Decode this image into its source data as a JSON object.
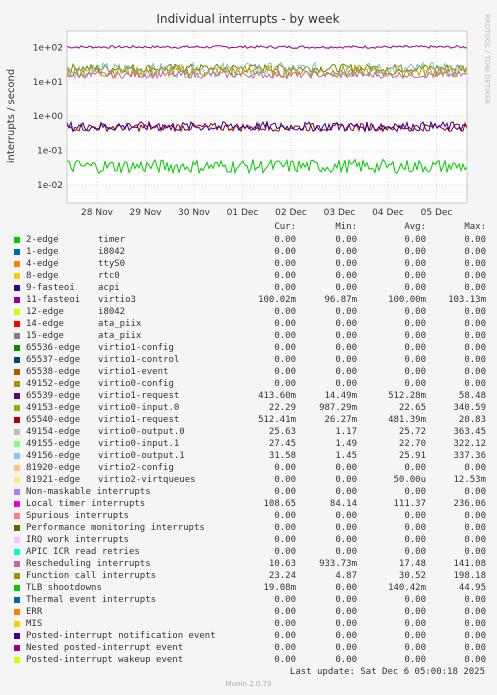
{
  "chart_data": {
    "type": "line",
    "title": "Individual interrupts - by week",
    "ylabel": "interrupts / second",
    "yscale": "log",
    "ylim": [
      0.003,
      300
    ],
    "y_ticks": [
      "1e+02",
      "1e+01",
      "1e+00",
      "1e-01",
      "1e-02"
    ],
    "x_ticks": [
      "28 Nov",
      "29 Nov",
      "30 Nov",
      "01 Dec",
      "02 Dec",
      "03 Dec",
      "04 Dec",
      "05 Dec"
    ],
    "side_label": "RRDTOOL / TOBI OETIKER",
    "series_bands": [
      {
        "name": "11-fasteoi virtio3",
        "color": "#990099",
        "level": 103,
        "noise": 0.04
      },
      {
        "name": "49153-edge virtio0-input.0",
        "color": "#7a7a00",
        "level": 25,
        "noise": 0.12
      },
      {
        "name": "49154-edge virtio0-output.0",
        "color": "#80c0c0",
        "level": 22,
        "noise": 0.22
      },
      {
        "name": "Local timer interrupts",
        "color": "#b0a000",
        "level": 20,
        "noise": 0.18
      },
      {
        "name": "Rescheduling interrupts",
        "color": "#cc6699",
        "level": 16,
        "noise": 0.1
      },
      {
        "name": "65540-edge virtio1-request",
        "color": "#990000",
        "level": 0.48,
        "noise": 0.12
      },
      {
        "name": "65539-edge virtio1-request",
        "color": "#330099",
        "level": 0.5,
        "noise": 0.14
      },
      {
        "name": "TLB shootdowns",
        "color": "#00cc00",
        "level": 0.035,
        "noise": 0.2
      }
    ]
  },
  "legend_header": {
    "cur": "Cur:",
    "min": "Min:",
    "avg": "Avg:",
    "max": "Max:"
  },
  "legend": [
    {
      "name": "2-edge",
      "device": "timer",
      "color": "#00cc00",
      "cur": "0.00",
      "min": "0.00",
      "avg": "0.00",
      "max": "0.00"
    },
    {
      "name": "1-edge",
      "device": "i8042",
      "color": "#0066b3",
      "cur": "0.00",
      "min": "0.00",
      "avg": "0.00",
      "max": "0.00"
    },
    {
      "name": "4-edge",
      "device": "ttyS0",
      "color": "#ff8000",
      "cur": "0.00",
      "min": "0.00",
      "avg": "0.00",
      "max": "0.00"
    },
    {
      "name": "8-edge",
      "device": "rtc0",
      "color": "#ffcc00",
      "cur": "0.00",
      "min": "0.00",
      "avg": "0.00",
      "max": "0.00"
    },
    {
      "name": "9-fasteoi",
      "device": "acpi",
      "color": "#330099",
      "cur": "0.00",
      "min": "0.00",
      "avg": "0.00",
      "max": "0.00"
    },
    {
      "name": "11-fasteoi",
      "device": "virtio3",
      "color": "#990099",
      "cur": "100.02m",
      "min": "96.87m",
      "avg": "100.00m",
      "max": "103.13m"
    },
    {
      "name": "12-edge",
      "device": "i8042",
      "color": "#ccff00",
      "cur": "0.00",
      "min": "0.00",
      "avg": "0.00",
      "max": "0.00"
    },
    {
      "name": "14-edge",
      "device": "ata_piix",
      "color": "#ff0000",
      "cur": "0.00",
      "min": "0.00",
      "avg": "0.00",
      "max": "0.00"
    },
    {
      "name": "15-edge",
      "device": "ata_piix",
      "color": "#808080",
      "cur": "0.00",
      "min": "0.00",
      "avg": "0.00",
      "max": "0.00"
    },
    {
      "name": "65536-edge",
      "device": "virtio1-config",
      "color": "#008f00",
      "cur": "0.00",
      "min": "0.00",
      "avg": "0.00",
      "max": "0.00"
    },
    {
      "name": "65537-edge",
      "device": "virtio1-control",
      "color": "#00487d",
      "cur": "0.00",
      "min": "0.00",
      "avg": "0.00",
      "max": "0.00"
    },
    {
      "name": "65538-edge",
      "device": "virtio1-event",
      "color": "#b35a00",
      "cur": "0.00",
      "min": "0.00",
      "avg": "0.00",
      "max": "0.00"
    },
    {
      "name": "49152-edge",
      "device": "virtio0-config",
      "color": "#b38f00",
      "cur": "0.00",
      "min": "0.00",
      "avg": "0.00",
      "max": "0.00"
    },
    {
      "name": "65539-edge",
      "device": "virtio1-request",
      "color": "#6b006b",
      "cur": "413.60m",
      "min": "14.49m",
      "avg": "512.28m",
      "max": "58.48"
    },
    {
      "name": "49153-edge",
      "device": "virtio0-input.0",
      "color": "#8fb300",
      "cur": "22.29",
      "min": "987.29m",
      "avg": "22.65",
      "max": "340.59"
    },
    {
      "name": "65540-edge",
      "device": "virtio1-request",
      "color": "#b30000",
      "cur": "512.41m",
      "min": "26.27m",
      "avg": "481.39m",
      "max": "20.83"
    },
    {
      "name": "49154-edge",
      "device": "virtio0-output.0",
      "color": "#bebebe",
      "cur": "25.63",
      "min": "1.17",
      "avg": "25.72",
      "max": "363.45"
    },
    {
      "name": "49155-edge",
      "device": "virtio0-input.1",
      "color": "#80ff80",
      "cur": "27.45",
      "min": "1.49",
      "avg": "22.70",
      "max": "322.12"
    },
    {
      "name": "49156-edge",
      "device": "virtio0-output.1",
      "color": "#80c9ff",
      "cur": "31.58",
      "min": "1.45",
      "avg": "25.91",
      "max": "337.36"
    },
    {
      "name": "81920-edge",
      "device": "virtio2-config",
      "color": "#ffc080",
      "cur": "0.00",
      "min": "0.00",
      "avg": "0.00",
      "max": "0.00"
    },
    {
      "name": "81921-edge",
      "device": "virtio2-virtqueues",
      "color": "#ffe680",
      "cur": "0.00",
      "min": "0.00",
      "avg": "50.00u",
      "max": "12.53m"
    },
    {
      "name": "Non-maskable interrupts",
      "device": "",
      "color": "#aa80ff",
      "cur": "0.00",
      "min": "0.00",
      "avg": "0.00",
      "max": "0.00"
    },
    {
      "name": "Local timer interrupts",
      "device": "",
      "color": "#ee00cc",
      "cur": "108.65",
      "min": "84.14",
      "avg": "111.37",
      "max": "236.06"
    },
    {
      "name": "Spurious interrupts",
      "device": "",
      "color": "#ff8080",
      "cur": "0.00",
      "min": "0.00",
      "avg": "0.00",
      "max": "0.00"
    },
    {
      "name": "Performance monitoring interrupts",
      "device": "",
      "color": "#666600",
      "cur": "0.00",
      "min": "0.00",
      "avg": "0.00",
      "max": "0.00"
    },
    {
      "name": "IRQ work interrupts",
      "device": "",
      "color": "#ffbfff",
      "cur": "0.00",
      "min": "0.00",
      "avg": "0.00",
      "max": "0.00"
    },
    {
      "name": "APIC ICR read retries",
      "device": "",
      "color": "#00ffcc",
      "cur": "0.00",
      "min": "0.00",
      "avg": "0.00",
      "max": "0.00"
    },
    {
      "name": "Rescheduling interrupts",
      "device": "",
      "color": "#cc6699",
      "cur": "10.63",
      "min": "933.73m",
      "avg": "17.48",
      "max": "141.08"
    },
    {
      "name": "Function call interrupts",
      "device": "",
      "color": "#999900",
      "cur": "23.24",
      "min": "4.87",
      "avg": "30.52",
      "max": "198.18"
    },
    {
      "name": "TLB shootdowns",
      "device": "",
      "color": "#00cc00",
      "cur": "19.08m",
      "min": "0.00",
      "avg": "140.42m",
      "max": "44.95"
    },
    {
      "name": "Thermal event interrupts",
      "device": "",
      "color": "#0066b3",
      "cur": "0.00",
      "min": "0.00",
      "avg": "0.00",
      "max": "0.00"
    },
    {
      "name": "ERR",
      "device": "",
      "color": "#ff8000",
      "cur": "0.00",
      "min": "0.00",
      "avg": "0.00",
      "max": "0.00"
    },
    {
      "name": "MIS",
      "device": "",
      "color": "#ffcc00",
      "cur": "0.00",
      "min": "0.00",
      "avg": "0.00",
      "max": "0.00"
    },
    {
      "name": "Posted-interrupt notification event",
      "device": "",
      "color": "#330099",
      "cur": "0.00",
      "min": "0.00",
      "avg": "0.00",
      "max": "0.00"
    },
    {
      "name": "Nested posted-interrupt event",
      "device": "",
      "color": "#990099",
      "cur": "0.00",
      "min": "0.00",
      "avg": "0.00",
      "max": "0.00"
    },
    {
      "name": "Posted-interrupt wakeup event",
      "device": "",
      "color": "#ccff00",
      "cur": "0.00",
      "min": "0.00",
      "avg": "0.00",
      "max": "0.00"
    }
  ],
  "last_update": "Last update: Sat Dec  6 05:00:18 2025",
  "munin_version": "Munin 2.0.73"
}
